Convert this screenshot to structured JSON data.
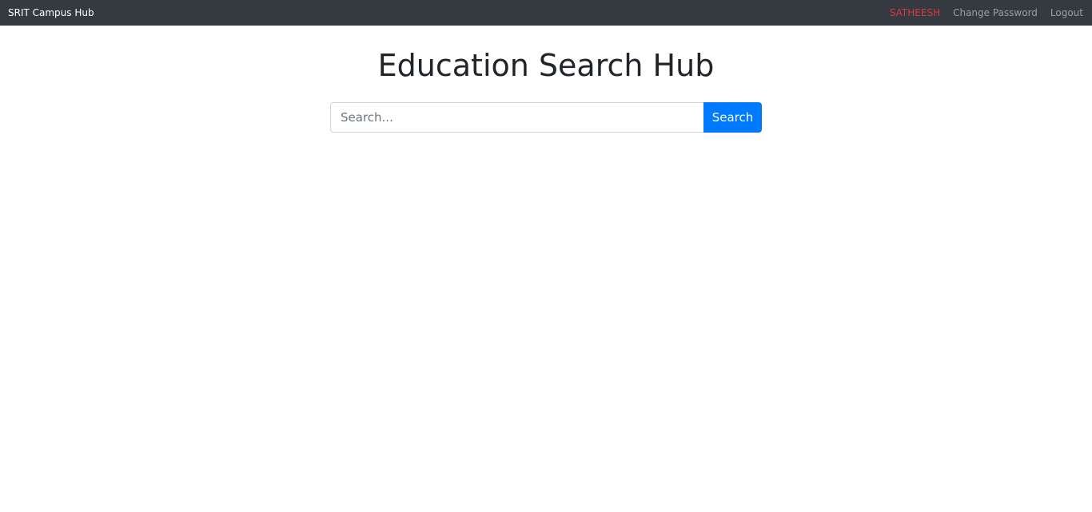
{
  "navbar": {
    "brand": "SRIT Campus Hub",
    "user": "SATHEESH",
    "links": {
      "change_password": "Change Password",
      "logout": "Logout"
    }
  },
  "main": {
    "title": "Education Search Hub",
    "search": {
      "placeholder": "Search...",
      "value": "",
      "button_label": "Search"
    }
  },
  "colors": {
    "navbar_bg": "#343a40",
    "user_text": "#dc3545",
    "accent": "#007bff"
  }
}
